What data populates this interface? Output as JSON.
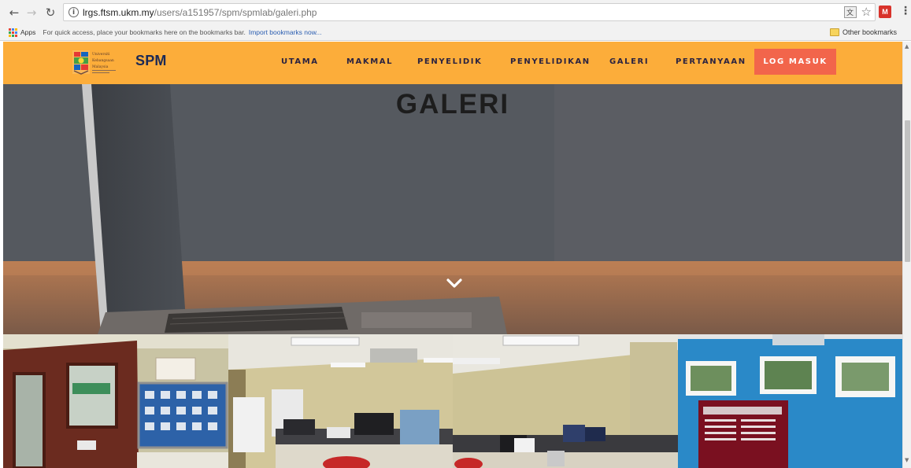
{
  "browser": {
    "url_host": "lrgs.ftsm.ukm.my",
    "url_path": "/users/a151957/spm/spmlab/galeri.php",
    "translate_icon": "translate-icon",
    "extension_label": "M",
    "bookmarks_bar": {
      "apps_label": "Apps",
      "hint": "For quick access, place your bookmarks here on the bookmarks bar.",
      "import_link": "Import bookmarks now...",
      "other_bookmarks": "Other bookmarks"
    }
  },
  "site": {
    "brand": "SPM",
    "logo_caption": [
      "Universiti",
      "Kebangsaan",
      "Malaysia"
    ],
    "menu": [
      {
        "label": "UTAMA"
      },
      {
        "label": "MAKMAL"
      },
      {
        "label": "PENYELIDIK"
      },
      {
        "label": "PENYELIDIKAN"
      },
      {
        "label": "GALERI"
      },
      {
        "label": "PERTANYAAN"
      }
    ],
    "login_label": "LOG MASUK",
    "hero_title": "GALERI",
    "colors": {
      "nav_background": "#fcad3a",
      "login_button": "#f2654b",
      "nav_text": "#2b2340",
      "brand_text": "#1c2a55"
    },
    "gallery": [
      {
        "subject": "lab-entrance-door-with-noticeboard"
      },
      {
        "subject": "office-workstations"
      },
      {
        "subject": "office-desks-ceiling-lights"
      },
      {
        "subject": "blue-wall-with-posters"
      }
    ]
  }
}
